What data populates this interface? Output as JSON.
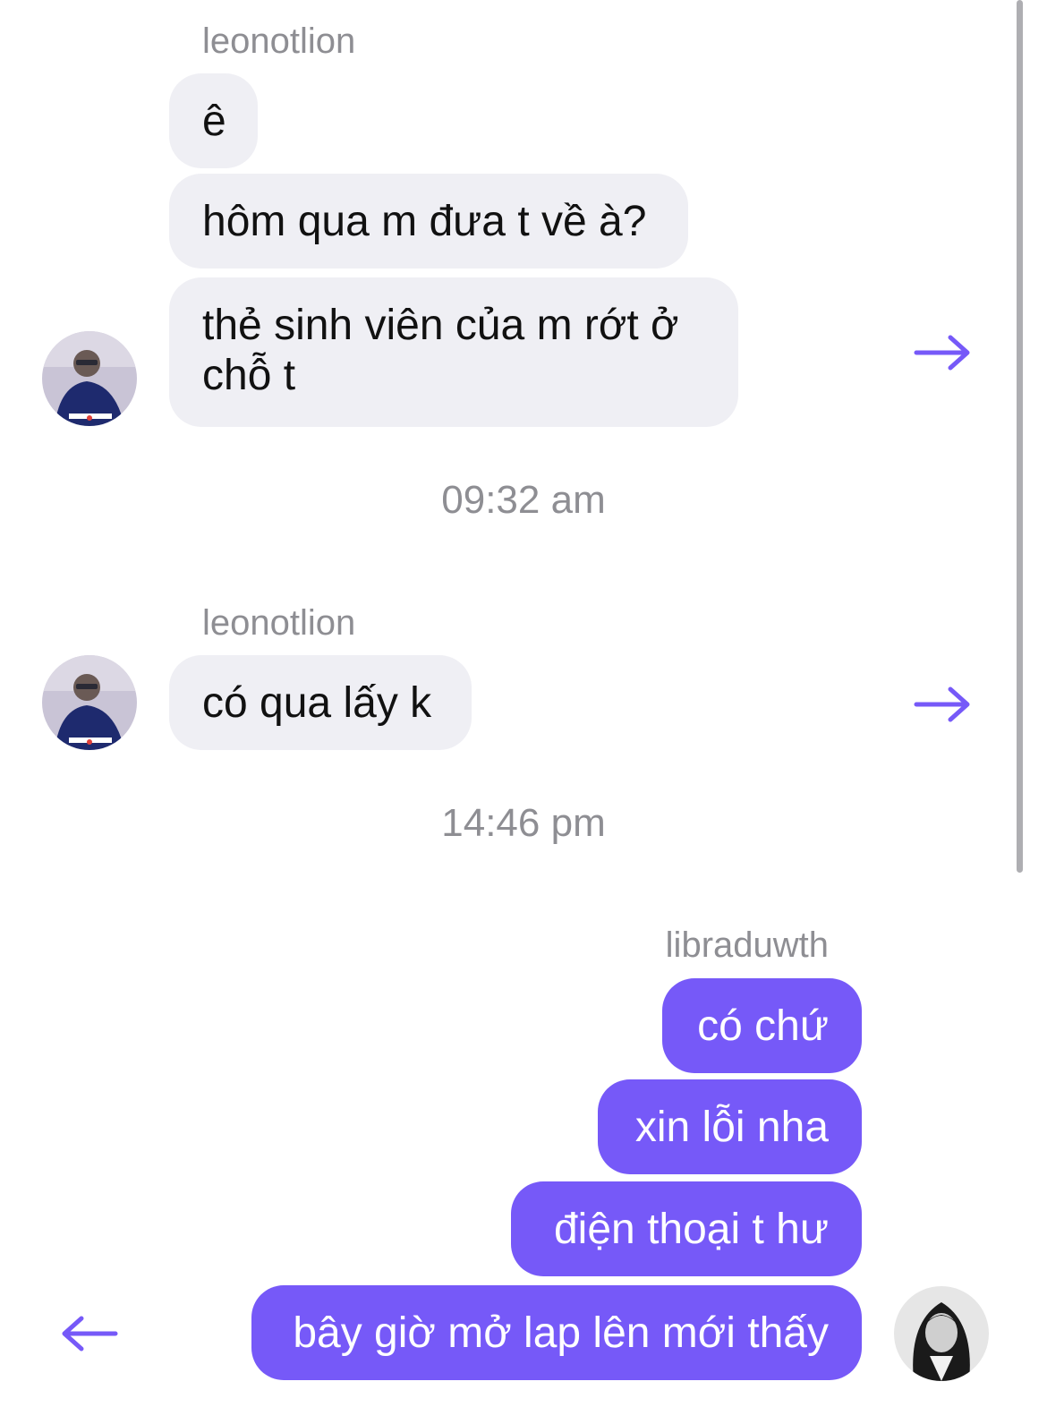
{
  "groups": [
    {
      "sender": "leonotlion",
      "messages": [
        "ê",
        "hôm qua m đưa t về à?",
        "thẻ sinh viên của m rớt ở\nchỗ t"
      ],
      "reply_icon": "arrow-right-icon"
    },
    {
      "timestamp": "09:32 am"
    },
    {
      "sender": "leonotlion",
      "messages": [
        "có qua lấy k"
      ],
      "reply_icon": "arrow-right-icon"
    },
    {
      "timestamp": "14:46 pm"
    },
    {
      "sender": "libraduwth",
      "messages": [
        "có chứ",
        "xin lỗi nha",
        "điện thoại t hư",
        "bây giờ mở lap lên mới thấy"
      ],
      "reply_icon": "arrow-left-icon"
    }
  ],
  "colors": {
    "outgoing_bubble": "#7659f8",
    "incoming_bubble": "#efeff4",
    "accent_arrow": "#7659f8",
    "meta_text": "#8e8e93"
  }
}
